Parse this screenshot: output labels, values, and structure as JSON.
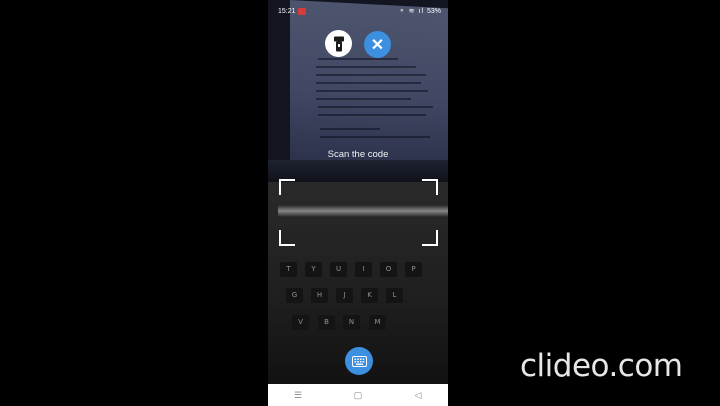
{
  "status_bar": {
    "time": "15:21",
    "battery": "53%",
    "system_icons": "⚬ ≋ ıl"
  },
  "header": {
    "flashlight_icon": "flashlight-icon",
    "close_icon": "close-icon",
    "close_glyph": "✕"
  },
  "scanner": {
    "instruction": "Scan the code"
  },
  "keyboard_button": {
    "icon": "keyboard-icon"
  },
  "nav_bar": {
    "recents": "☰",
    "home": "▢",
    "back": "◁"
  },
  "watermark": {
    "text": "clideo.com"
  },
  "colors": {
    "accent": "#3d8fe0",
    "background": "#000000",
    "nav_bar": "#ffffff"
  }
}
